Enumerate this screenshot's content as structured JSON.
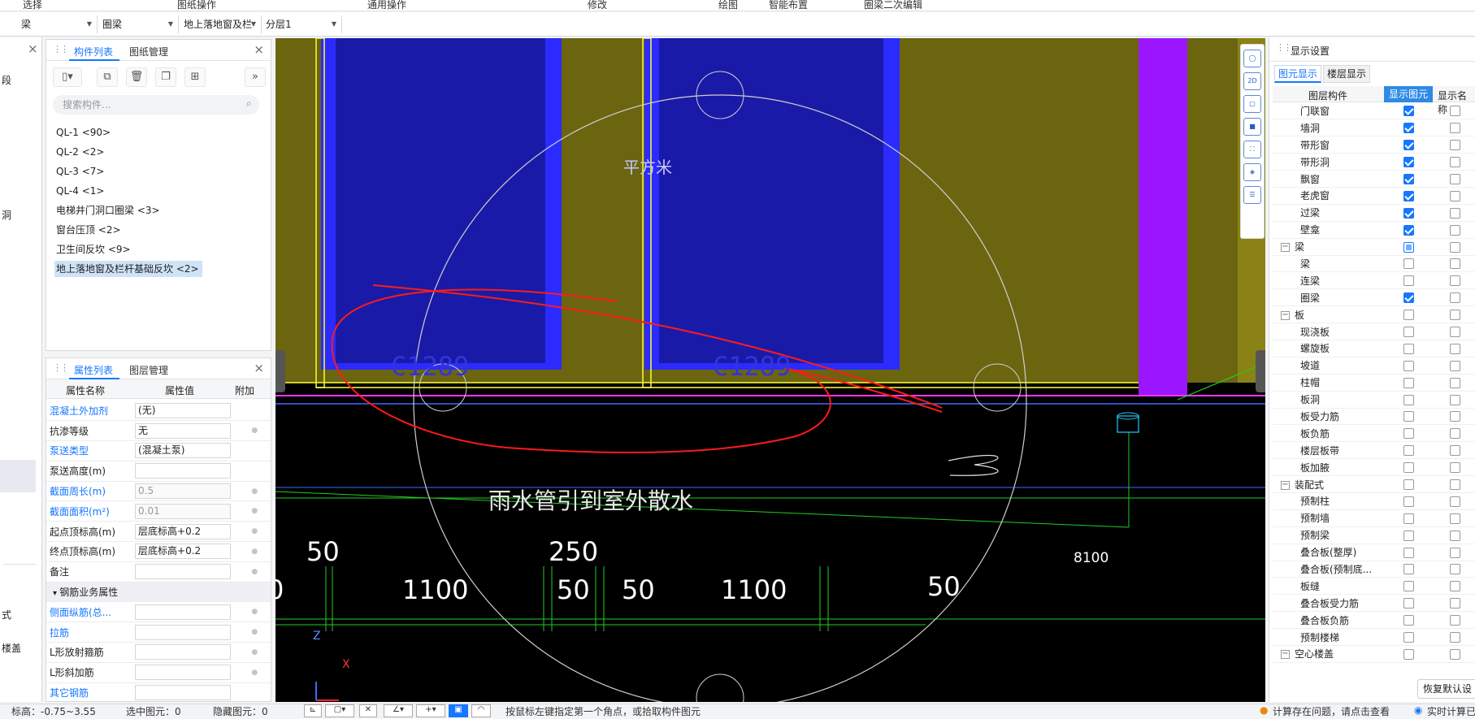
{
  "top_menu": [
    "选择",
    "图纸操作",
    "通用操作",
    "修改",
    "绘图",
    "智能布置",
    "圈梁二次编辑"
  ],
  "selectors": [
    {
      "value": "梁"
    },
    {
      "value": "圈梁"
    },
    {
      "value": "地上落地窗及栏"
    },
    {
      "value": "分层1"
    }
  ],
  "left_strip_labels": [
    "段",
    "洞",
    "式",
    "楼盖"
  ],
  "component_panel": {
    "tabs": [
      "构件列表",
      "图纸管理"
    ],
    "search_placeholder": "搜索构件...",
    "items": [
      "QL-1 <90>",
      "QL-2 <2>",
      "QL-3 <7>",
      "QL-4 <1>",
      "电梯井门洞口圈梁 <3>",
      "窗台压顶 <2>",
      "卫生间反坎 <9>",
      "地上落地窗及栏杆基础反坎 <2>"
    ],
    "selected_index": 7
  },
  "property_panel": {
    "tabs": [
      "属性列表",
      "图层管理"
    ],
    "headers": [
      "属性名称",
      "属性值",
      "附加"
    ],
    "rows": [
      {
        "name": "混凝土外加剂",
        "value": "(无)",
        "blue": true,
        "gray": false,
        "dot": false
      },
      {
        "name": "抗渗等级",
        "value": "无",
        "blue": false,
        "gray": false,
        "dot": true
      },
      {
        "name": "泵送类型",
        "value": "(混凝土泵)",
        "blue": true,
        "gray": false,
        "dot": false
      },
      {
        "name": "泵送高度(m)",
        "value": "",
        "blue": false,
        "gray": false,
        "dot": false
      },
      {
        "name": "截面周长(m)",
        "value": "0.5",
        "blue": true,
        "gray": true,
        "dot": true
      },
      {
        "name": "截面面积(m²)",
        "value": "0.01",
        "blue": true,
        "gray": true,
        "dot": true
      },
      {
        "name": "起点顶标高(m)",
        "value": "层底标高+0.2",
        "blue": false,
        "gray": false,
        "dot": true
      },
      {
        "name": "终点顶标高(m)",
        "value": "层底标高+0.2",
        "blue": false,
        "gray": false,
        "dot": true
      },
      {
        "name": "备注",
        "value": "",
        "blue": false,
        "gray": false,
        "dot": true
      }
    ],
    "section": "钢筋业务属性",
    "rows2": [
      {
        "name": "侧面纵筋(总...",
        "value": "",
        "blue": true,
        "dot": true
      },
      {
        "name": "拉筋",
        "value": "",
        "blue": true,
        "dot": true
      },
      {
        "name": "L形放射箍筋",
        "value": "",
        "blue": false,
        "dot": true
      },
      {
        "name": "L形斜加筋",
        "value": "",
        "blue": false,
        "dot": true
      },
      {
        "name": "其它钢筋",
        "value": "",
        "blue": true,
        "dot": false
      }
    ]
  },
  "canvas": {
    "labels": {
      "window1": "C1289",
      "window2": "C1289",
      "area": "平方米",
      "note": "雨水管引到室外散水",
      "dim_8100": "8100",
      "axis_x": "X",
      "axis_z": "Z"
    },
    "dims_row1": [
      "50",
      "250",
      "50"
    ],
    "dims_row2": [
      "0",
      "1100",
      "50",
      "50",
      "1100"
    ]
  },
  "display_panel": {
    "title": "显示设置",
    "tabs": [
      "图元显示",
      "楼层显示"
    ],
    "headers": [
      "图层构件",
      "显示图元",
      "显示名称"
    ],
    "rows": [
      {
        "label": "门联窗",
        "group": false,
        "c1": "on",
        "c2": "off"
      },
      {
        "label": "墙洞",
        "group": false,
        "c1": "on",
        "c2": "off"
      },
      {
        "label": "带形窗",
        "group": false,
        "c1": "on",
        "c2": "off"
      },
      {
        "label": "带形洞",
        "group": false,
        "c1": "on",
        "c2": "off"
      },
      {
        "label": "飘窗",
        "group": false,
        "c1": "on",
        "c2": "off"
      },
      {
        "label": "老虎窗",
        "group": false,
        "c1": "on",
        "c2": "off"
      },
      {
        "label": "过梁",
        "group": false,
        "c1": "on",
        "c2": "off"
      },
      {
        "label": "壁龛",
        "group": false,
        "c1": "on",
        "c2": "off"
      },
      {
        "label": "梁",
        "group": true,
        "c1": "part",
        "c2": "off"
      },
      {
        "label": "梁",
        "group": false,
        "c1": "off",
        "c2": "off"
      },
      {
        "label": "连梁",
        "group": false,
        "c1": "off",
        "c2": "off"
      },
      {
        "label": "圈梁",
        "group": false,
        "c1": "on",
        "c2": "off"
      },
      {
        "label": "板",
        "group": true,
        "c1": "off",
        "c2": "off"
      },
      {
        "label": "现浇板",
        "group": false,
        "c1": "off",
        "c2": "off"
      },
      {
        "label": "螺旋板",
        "group": false,
        "c1": "off",
        "c2": "off"
      },
      {
        "label": "坡道",
        "group": false,
        "c1": "off",
        "c2": "off"
      },
      {
        "label": "柱帽",
        "group": false,
        "c1": "off",
        "c2": "off"
      },
      {
        "label": "板洞",
        "group": false,
        "c1": "off",
        "c2": "off"
      },
      {
        "label": "板受力筋",
        "group": false,
        "c1": "off",
        "c2": "off"
      },
      {
        "label": "板负筋",
        "group": false,
        "c1": "off",
        "c2": "off"
      },
      {
        "label": "楼层板带",
        "group": false,
        "c1": "off",
        "c2": "off"
      },
      {
        "label": "板加腋",
        "group": false,
        "c1": "off",
        "c2": "off"
      },
      {
        "label": "装配式",
        "group": true,
        "c1": "off",
        "c2": "off"
      },
      {
        "label": "预制柱",
        "group": false,
        "c1": "off",
        "c2": "off"
      },
      {
        "label": "预制墙",
        "group": false,
        "c1": "off",
        "c2": "off"
      },
      {
        "label": "预制梁",
        "group": false,
        "c1": "off",
        "c2": "off"
      },
      {
        "label": "叠合板(整厚)",
        "group": false,
        "c1": "off",
        "c2": "off"
      },
      {
        "label": "叠合板(预制底...",
        "group": false,
        "c1": "off",
        "c2": "off"
      },
      {
        "label": "板缝",
        "group": false,
        "c1": "off",
        "c2": "off"
      },
      {
        "label": "叠合板受力筋",
        "group": false,
        "c1": "off",
        "c2": "off"
      },
      {
        "label": "叠合板负筋",
        "group": false,
        "c1": "off",
        "c2": "off"
      },
      {
        "label": "预制楼梯",
        "group": false,
        "c1": "off",
        "c2": "off"
      },
      {
        "label": "空心楼盖",
        "group": true,
        "c1": "off",
        "c2": "off"
      }
    ],
    "restore_button": "恢复默认设"
  },
  "status_bar": {
    "elevation": "标高：-0.75~3.55",
    "selected": "选中图元：0",
    "hidden": "隐藏图元：0",
    "hint": "按鼠标左键指定第一个角点，或拾取构件图元",
    "warning": "计算存在问题，请点击查看",
    "realtime": "实时计算已"
  }
}
